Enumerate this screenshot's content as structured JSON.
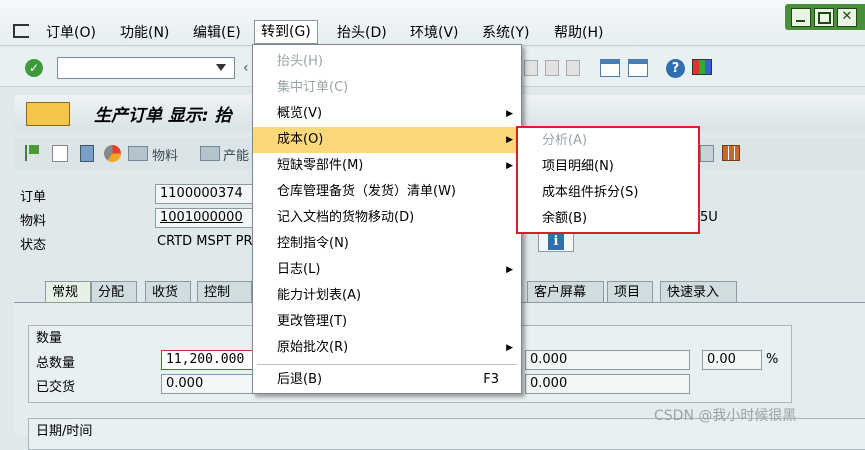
{
  "menubar": {
    "items": [
      "订单(O)",
      "功能(N)",
      "编辑(E)",
      "转到(G)",
      "抬头(D)",
      "环境(V)",
      "系统(Y)",
      "帮助(H)"
    ],
    "active_index": 3
  },
  "title": {
    "text": "生产订单 显示: 抬"
  },
  "app_toolbar": {
    "material_label": "物料",
    "capacity_label": "产能"
  },
  "header_fields": {
    "order_label": "订单",
    "order_value": "1100000374",
    "material_label": "物料",
    "material_value": "1001000000",
    "status_label": "状态",
    "status_value": "CRTD MSPT PR",
    "material_trail": "5U"
  },
  "tabs": {
    "left": [
      "常规",
      "分配",
      "收货",
      "控制"
    ],
    "right": [
      "客户屏幕",
      "项目",
      "快速录入"
    ]
  },
  "quantity_group": {
    "title": "数量",
    "total_label": "总数量",
    "total_value": "11,200.000",
    "delivered_label": "已交货",
    "delivered_value": "0.000",
    "right_value1": "0.000",
    "right_value2": "0.000",
    "percent_value": "0.00",
    "percent_unit": "%"
  },
  "dates_group": {
    "title": "日期/时间"
  },
  "goto_menu": {
    "items": [
      {
        "label": "抬头(H)",
        "disabled": true
      },
      {
        "label": "集中订单(C)",
        "disabled": true
      },
      {
        "label": "概览(V)",
        "submenu": true
      },
      {
        "label": "成本(O)",
        "submenu": true,
        "highlighted": true
      },
      {
        "label": "短缺零部件(M)",
        "submenu": true
      },
      {
        "label": "仓库管理备货（发货）清单(W)"
      },
      {
        "label": "记入文档的货物移动(D)"
      },
      {
        "label": "控制指令(N)"
      },
      {
        "label": "日志(L)",
        "submenu": true
      },
      {
        "label": "能力计划表(A)"
      },
      {
        "label": "更改管理(T)"
      },
      {
        "label": "原始批次(R)",
        "submenu": true
      },
      {
        "label": "后退(B)",
        "shortcut": "F3"
      }
    ]
  },
  "cost_submenu": {
    "items": [
      {
        "label": "分析(A)",
        "disabled": true
      },
      {
        "label": "项目明细(N)"
      },
      {
        "label": "成本组件拆分(S)"
      },
      {
        "label": "余额(B)"
      }
    ]
  },
  "watermark": "CSDN @我小时候很黑",
  "colors": {
    "highlight": "#fbd97a",
    "submenu_border": "#d9202a",
    "window_green": "#4a8d3a"
  }
}
